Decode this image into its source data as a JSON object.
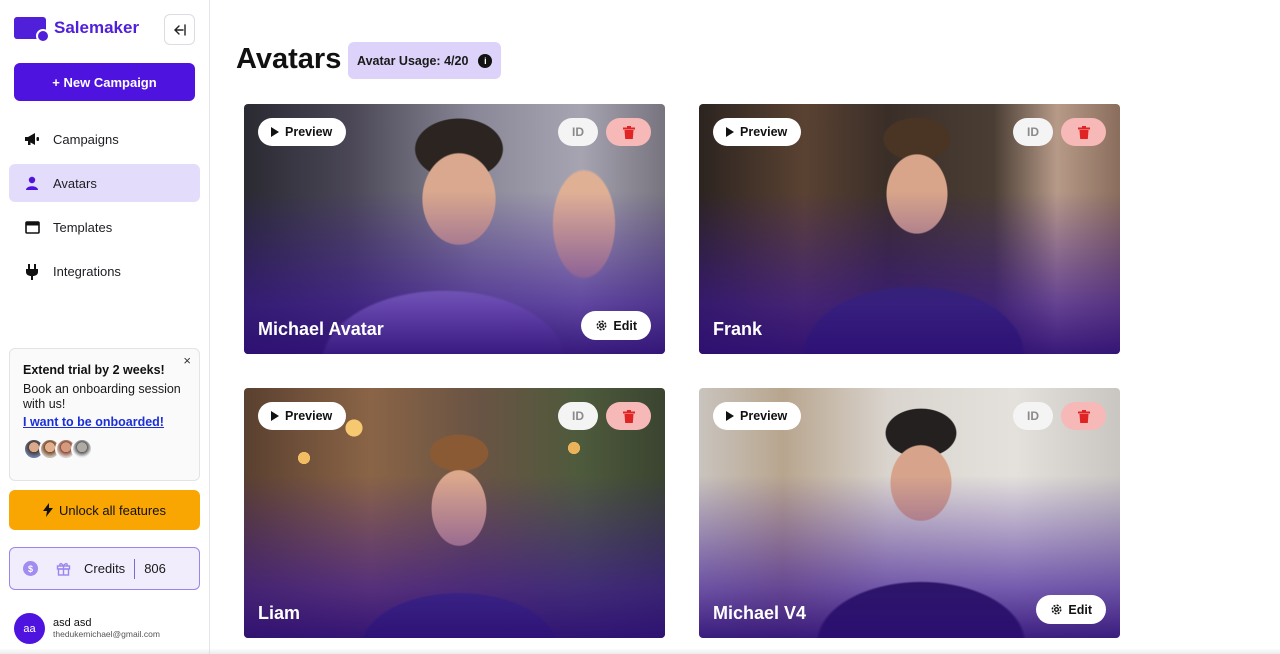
{
  "brand": {
    "name": "Salemaker"
  },
  "sidebar": {
    "new_campaign": "+ New Campaign",
    "items": [
      {
        "label": "Campaigns",
        "icon": "megaphone-icon",
        "active": false
      },
      {
        "label": "Avatars",
        "icon": "person-icon",
        "active": true
      },
      {
        "label": "Templates",
        "icon": "window-icon",
        "active": false
      },
      {
        "label": "Integrations",
        "icon": "plug-icon",
        "active": false
      }
    ],
    "trial": {
      "close": "×",
      "title": "Extend trial by 2 weeks!",
      "body": "Book an onboarding session with us!",
      "link": "I want to be onboarded!"
    },
    "unlock": "Unlock all features",
    "credits": {
      "coin": "$",
      "label": "Credits",
      "value": "806"
    },
    "user": {
      "initials": "aa",
      "name": "asd asd",
      "email": "thedukemichael@gmail.com"
    }
  },
  "main": {
    "title": "Avatars",
    "usage": "Avatar Usage: 4/20",
    "preview_label": "Preview",
    "id_label": "ID",
    "edit_label": "Edit",
    "avatars": [
      {
        "name": "Michael Avatar",
        "editable": true
      },
      {
        "name": "Frank",
        "editable": false
      },
      {
        "name": "Liam",
        "editable": false
      },
      {
        "name": "Michael V4",
        "editable": true
      }
    ]
  },
  "colors": {
    "brand": "#4f13df",
    "active_nav": "#e4dcfb",
    "unlock": "#f9a602",
    "delete_bg": "#f7b8b8",
    "delete_icon": "#e02424"
  }
}
